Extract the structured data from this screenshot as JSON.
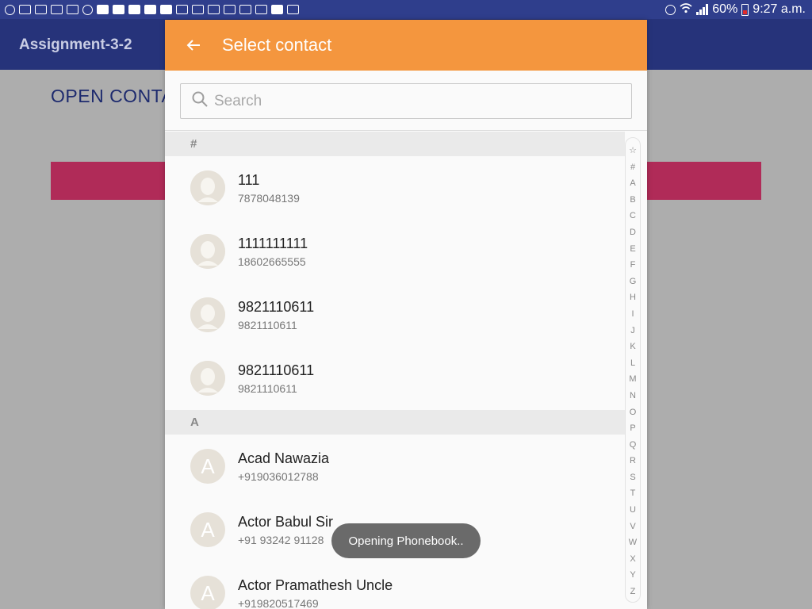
{
  "status_bar": {
    "battery": "60%",
    "time": "9:27 a.m."
  },
  "app": {
    "title": "Assignment-3-2",
    "open_contact_label": "OPEN CONTA",
    "colors": {
      "appbar": "#26337a",
      "accent": "#b02b58"
    }
  },
  "dialog": {
    "title": "Select contact",
    "back_icon": "arrow-left-icon",
    "header_color": "#f4963e",
    "search": {
      "placeholder": "Search",
      "value": ""
    }
  },
  "sections": [
    {
      "header": "#",
      "contacts": [
        {
          "name": "111",
          "phone": "7878048139",
          "avatar": ""
        },
        {
          "name": "1111111111",
          "phone": "18602665555",
          "avatar": ""
        },
        {
          "name": "9821110611",
          "phone": "9821110611",
          "avatar": ""
        },
        {
          "name": "9821110611",
          "phone": "9821110611",
          "avatar": ""
        }
      ]
    },
    {
      "header": "A",
      "contacts": [
        {
          "name": "Acad Nawazia",
          "phone": "+919036012788",
          "avatar": "A"
        },
        {
          "name": "Actor Babul Sir",
          "phone": "+91 93242 91128",
          "avatar": "A"
        },
        {
          "name": "Actor Pramathesh Uncle",
          "phone": "+919820517469",
          "avatar": "A"
        }
      ]
    }
  ],
  "alpha_index": [
    "☆",
    "#",
    "A",
    "B",
    "C",
    "D",
    "E",
    "F",
    "G",
    "H",
    "I",
    "J",
    "K",
    "L",
    "M",
    "N",
    "O",
    "P",
    "Q",
    "R",
    "S",
    "T",
    "U",
    "V",
    "W",
    "X",
    "Y",
    "Z"
  ],
  "toast": "Opening Phonebook.."
}
